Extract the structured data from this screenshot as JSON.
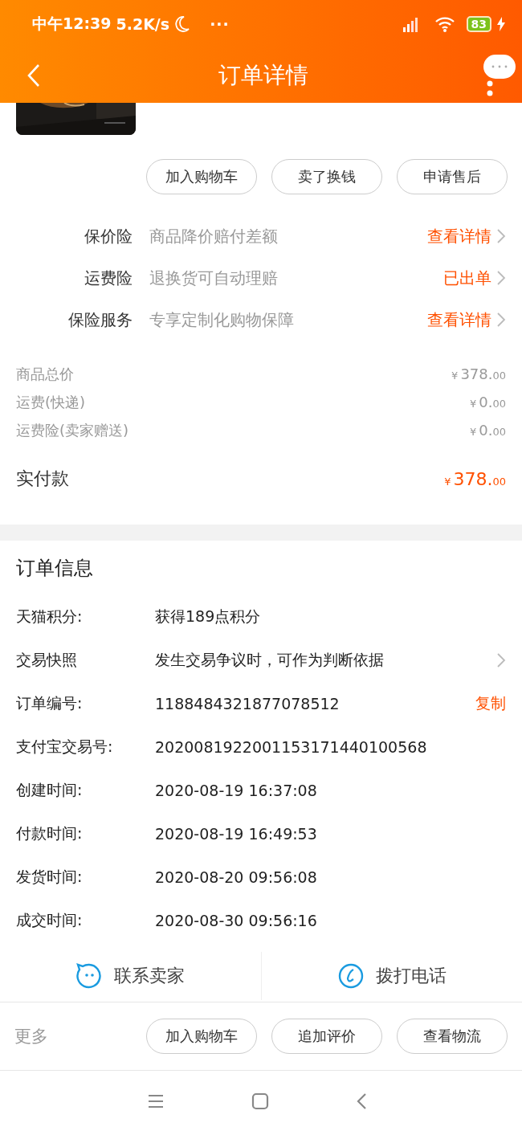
{
  "status_bar": {
    "time": "中午12:39",
    "speed": "5.2K/s",
    "more": "···",
    "battery": "83"
  },
  "header": {
    "title": "订单详情"
  },
  "actions": [
    "加入购物车",
    "卖了换钱",
    "申请售后"
  ],
  "services": [
    {
      "label": "保价险",
      "description": "商品降价赔付差额",
      "link": "查看详情"
    },
    {
      "label": "运费险",
      "description": "退换货可自动理赔",
      "link": "已出单"
    },
    {
      "label": "保险服务",
      "description": "专享定制化购物保障",
      "link": "查看详情"
    }
  ],
  "price_summary": {
    "rows": [
      {
        "label": "商品总价",
        "currency": "¥",
        "amount": "378.",
        "cents": "00"
      },
      {
        "label": "运费(快递)",
        "currency": "¥",
        "amount": "0.",
        "cents": "00"
      },
      {
        "label": "运费险(卖家赠送)",
        "currency": "¥",
        "amount": "0.",
        "cents": "00"
      }
    ],
    "total": {
      "label": "实付款",
      "currency": "¥",
      "amount": "378.",
      "cents": "00"
    }
  },
  "order_info": {
    "title": "订单信息",
    "rows": [
      {
        "kind": "plain",
        "label": "天猫积分:",
        "value": "获得189点积分"
      },
      {
        "kind": "link",
        "label": "交易快照",
        "value": "发生交易争议时，可作为判断依据"
      },
      {
        "kind": "copy",
        "label": "订单编号:",
        "value": "1188484321877078512",
        "action": "复制"
      },
      {
        "kind": "plain",
        "label": "支付宝交易号:",
        "value": "2020081922001153171440100568"
      },
      {
        "kind": "plain",
        "label": "创建时间:",
        "value": "2020-08-19 16:37:08"
      },
      {
        "kind": "plain",
        "label": "付款时间:",
        "value": "2020-08-19 16:49:53"
      },
      {
        "kind": "plain",
        "label": "发货时间:",
        "value": "2020-08-20 09:56:08"
      },
      {
        "kind": "plain",
        "label": "成交时间:",
        "value": "2020-08-30 09:56:16"
      }
    ]
  },
  "contact": [
    {
      "kind": "chat",
      "label": "联系卖家"
    },
    {
      "kind": "phone",
      "label": "拨打电话"
    }
  ],
  "more_bar": {
    "label": "更多",
    "buttons": [
      "加入购物车",
      "追加评价",
      "查看物流"
    ]
  }
}
